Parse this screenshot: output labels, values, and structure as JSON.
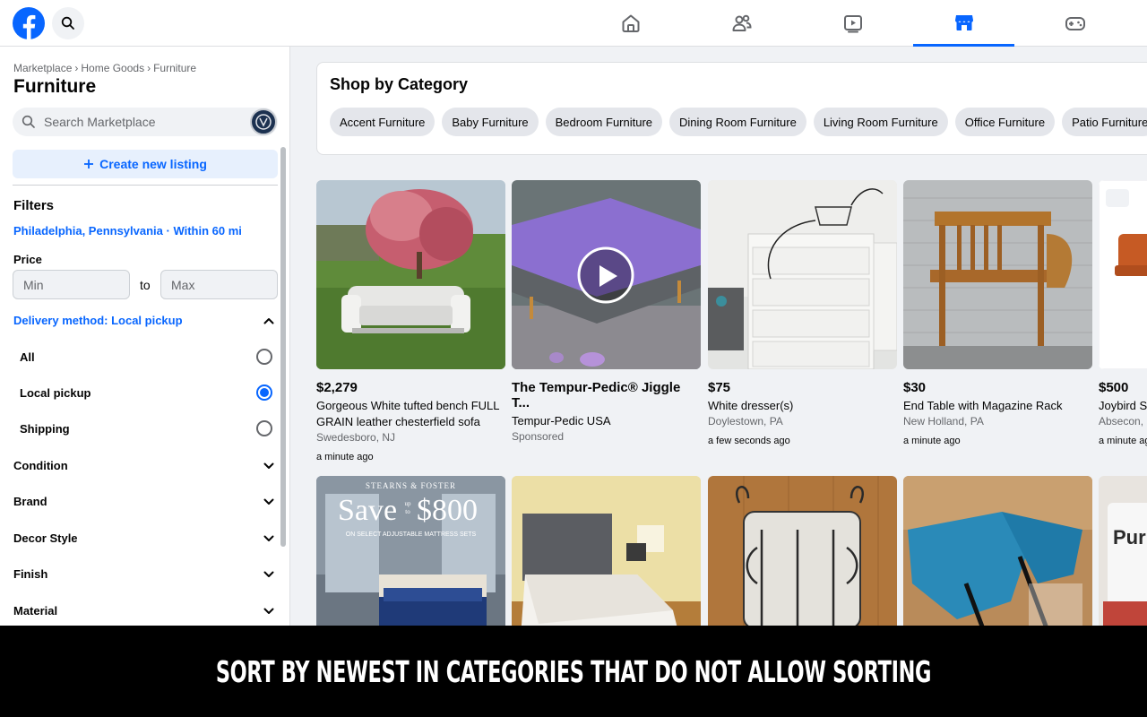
{
  "nav": {
    "tabs": [
      {
        "icon": "home-icon",
        "active": false
      },
      {
        "icon": "friends-icon",
        "active": false
      },
      {
        "icon": "video-icon",
        "active": false
      },
      {
        "icon": "marketplace-icon",
        "active": true
      },
      {
        "icon": "gaming-icon",
        "active": false
      }
    ],
    "accent_color": "#0866ff"
  },
  "sidebar": {
    "breadcrumb": [
      "Marketplace",
      "Home Goods",
      "Furniture"
    ],
    "breadcrumb_sep": "›",
    "title": "Furniture",
    "search_placeholder": "Search Marketplace",
    "create_listing_label": "Create new listing",
    "filters_heading": "Filters",
    "location": "Philadelphia, Pennsylvania · Within 60 mi",
    "price_heading": "Price",
    "price_min_placeholder": "Min",
    "price_max_placeholder": "Max",
    "price_to": "to",
    "delivery_heading": "Delivery method: Local pickup",
    "delivery_options": [
      {
        "label": "All",
        "selected": false
      },
      {
        "label": "Local pickup",
        "selected": true
      },
      {
        "label": "Shipping",
        "selected": false
      }
    ],
    "filter_sections": [
      "Condition",
      "Brand",
      "Decor Style",
      "Finish",
      "Material"
    ]
  },
  "shop": {
    "title": "Shop by Category",
    "categories": [
      "Accent Furniture",
      "Baby Furniture",
      "Bedroom Furniture",
      "Dining Room Furniture",
      "Living Room Furniture",
      "Office Furniture",
      "Patio Furniture"
    ]
  },
  "listings": [
    {
      "price": "$2,279",
      "title": "Gorgeous White tufted bench FULL GRAIN leather chesterfield sofa",
      "location": "Swedesboro, NJ",
      "time": "a minute ago"
    },
    {
      "price": "The Tempur-Pedic® Jiggle T...",
      "title": "Tempur-Pedic USA",
      "location": "Sponsored",
      "time": ""
    },
    {
      "price": "$75",
      "title": "White dresser(s)",
      "location": "Doylestown, PA",
      "time": "a few seconds ago"
    },
    {
      "price": "$30",
      "title": "End Table with Magazine Rack",
      "location": "New Holland, PA",
      "time": "a minute ago"
    },
    {
      "price": "$500",
      "title": "Joybird S",
      "location": "Absecon, N",
      "time": "a minute ag"
    }
  ],
  "ad_image": {
    "brand": "STEARNS & FOSTER",
    "save_word": "Save",
    "up_to": "up to",
    "amount": "$800",
    "tagline": "ON SELECT ADJUSTABLE MATTRESS SETS"
  },
  "bag_text": "Pur",
  "banner": {
    "text": "SORT BY NEWEST IN CATEGORIES THAT DO NOT ALLOW SORTING"
  }
}
